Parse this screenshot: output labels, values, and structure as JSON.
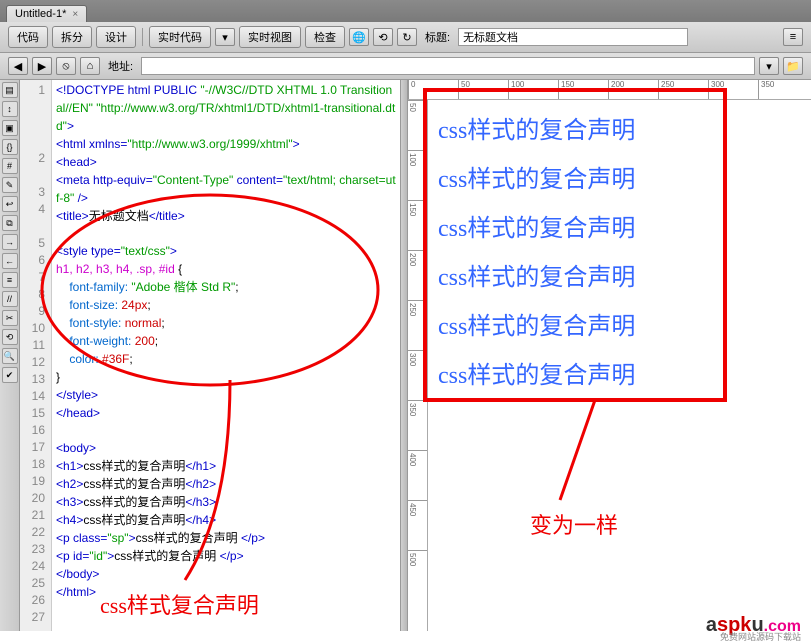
{
  "tab": {
    "title": "Untitled-1*",
    "close": "×"
  },
  "toolbar1": {
    "code": "代码",
    "split": "拆分",
    "design": "设计",
    "live_code": "实时代码",
    "live_view": "实时视图",
    "inspect": "检查",
    "title_label": "标题:",
    "title_value": "无标题文档"
  },
  "toolbar2": {
    "addr_label": "地址:",
    "addr_value": ""
  },
  "code_lines": [
    "1",
    "2",
    "3",
    "4",
    "5",
    "6",
    "7",
    "8",
    "9",
    "10",
    "11",
    "12",
    "13",
    "14",
    "15",
    "16",
    "17",
    "18",
    "19",
    "20",
    "21",
    "22",
    "23",
    "24",
    "25",
    "26",
    "27"
  ],
  "code": {
    "l1a": "<!DOCTYPE html PUBLIC ",
    "l1b": "\"-//W3C//DTD XHTML 1.0 Transitional//EN\"",
    "l1c": " \"http://www.w3.org/TR/xhtml1/DTD/xhtml1-transitional.dtd\"",
    "l1d": ">",
    "l2a": "<html xmlns=",
    "l2b": "\"http://www.w3.org/1999/xhtml\"",
    "l2c": ">",
    "l3": "<head>",
    "l4a": "<meta http-equiv=",
    "l4b": "\"Content-Type\"",
    "l4c": " content=",
    "l4d": "\"text/html; charset=utf-8\"",
    "l4e": " />",
    "l5a": "<title>",
    "l5b": "无标题文档",
    "l5c": "</title>",
    "l7a": "<style type=",
    "l7b": "\"text/css\"",
    "l7c": ">",
    "l8a": "h1, h2, h3, h4, .sp, #id",
    "l8b": " {",
    "l9a": "    font-family:",
    "l9b": " \"Adobe 楷体 Std R\"",
    "l9c": ";",
    "l10a": "    font-size:",
    "l10b": " 24px",
    "l10c": ";",
    "l11a": "    font-style:",
    "l11b": " normal",
    "l11c": ";",
    "l12a": "    font-weight:",
    "l12b": " 200",
    "l12c": ";",
    "l13a": "    color:",
    "l13b": " #36F",
    "l13c": ";",
    "l14": "}",
    "l15": "</style>",
    "l16": "</head>",
    "l18": "<body>",
    "l19a": "<h1>",
    "l19b": "css样式的复合声明",
    "l19c": "</h1>",
    "l20a": "<h2>",
    "l20b": "css样式的复合声明",
    "l20c": "</h2>",
    "l21a": "<h3>",
    "l21b": "css样式的复合声明",
    "l21c": "</h3>",
    "l22a": "<h4>",
    "l22b": "css样式的复合声明",
    "l22c": "</h4>",
    "l23a": "<p class=",
    "l23b": "\"sp\"",
    "l23c": ">",
    "l23d": "css样式的复合声明 ",
    "l23e": "</p>",
    "l24a": "<p id=",
    "l24b": "\"id\"",
    "l24c": ">",
    "l24d": "css样式的复合声明 ",
    "l24e": "</p>",
    "l25": "</body>",
    "l26": "</html>"
  },
  "preview_text": "css样式的复合声明",
  "ruler_h": [
    "0",
    "50",
    "100",
    "150",
    "200",
    "250",
    "300",
    "350"
  ],
  "ruler_v": [
    "50",
    "100",
    "150",
    "200",
    "250",
    "300",
    "350",
    "400",
    "450",
    "500"
  ],
  "annotations": {
    "bottom_caption": "css样式复合声明",
    "right_caption": "变为一样"
  },
  "logo": {
    "a": "a",
    "spk": "spk",
    "u": "u",
    "dotcom": ".com",
    "sub": "免费网站源码下载站"
  }
}
